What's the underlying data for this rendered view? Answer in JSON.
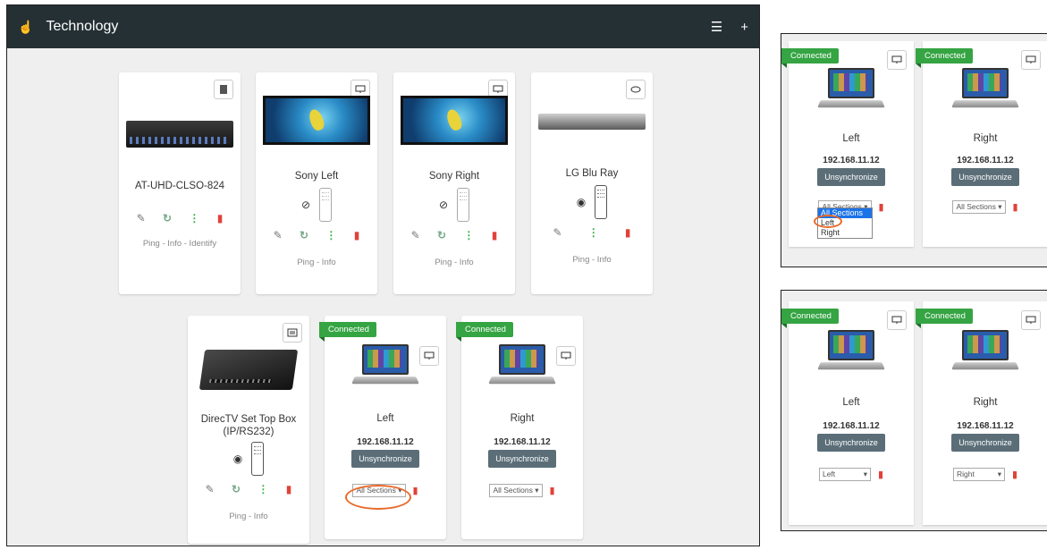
{
  "header": {
    "title": "Technology",
    "filter_icon": "sliders-icon",
    "add_label": "+"
  },
  "devices": [
    {
      "name": "AT-UHD-CLSO-824",
      "type_icon": "hdmi-icon",
      "links": "Ping - Info - Identify"
    },
    {
      "name": "Sony Left",
      "type_icon": "monitor-icon",
      "links": "Ping - Info"
    },
    {
      "name": "Sony Right",
      "type_icon": "monitor-icon",
      "links": "Ping - Info"
    },
    {
      "name": "LG Blu Ray",
      "type_icon": "disc-icon",
      "links": "Ping - Info"
    },
    {
      "name": "DirecTV Set Top Box (IP/RS232)",
      "type_icon": "message-icon",
      "links": "Ping - Info"
    }
  ],
  "computers": [
    {
      "status": "Connected",
      "name": "Left",
      "ip": "192.168.11.12",
      "button": "Unsynchronize",
      "section": "All Sections"
    },
    {
      "status": "Connected",
      "name": "Right",
      "ip": "192.168.11.12",
      "button": "Unsynchronize",
      "section": "All Sections"
    }
  ],
  "inset_top": {
    "computers": [
      {
        "status": "Connected",
        "name": "Left",
        "ip": "192.168.11.12",
        "button": "Unsynchronize",
        "section": "All Sections"
      },
      {
        "status": "Connected",
        "name": "Right",
        "ip": "192.168.11.12",
        "button": "Unsynchronize",
        "section": "All Sections"
      }
    ],
    "dropdown_options": [
      "All Sections",
      "Left",
      "Right"
    ]
  },
  "inset_bottom": {
    "computers": [
      {
        "status": "Connected",
        "name": "Left",
        "ip": "192.168.11.12",
        "button": "Unsynchronize",
        "section": "Left"
      },
      {
        "status": "Connected",
        "name": "Right",
        "ip": "192.168.11.12",
        "button": "Unsynchronize",
        "section": "Right"
      }
    ]
  },
  "colors": {
    "header_bg": "#253035",
    "connected": "#35a443",
    "button": "#5b6e78",
    "delete": "#e0423a",
    "highlight": "#e86a2a"
  }
}
